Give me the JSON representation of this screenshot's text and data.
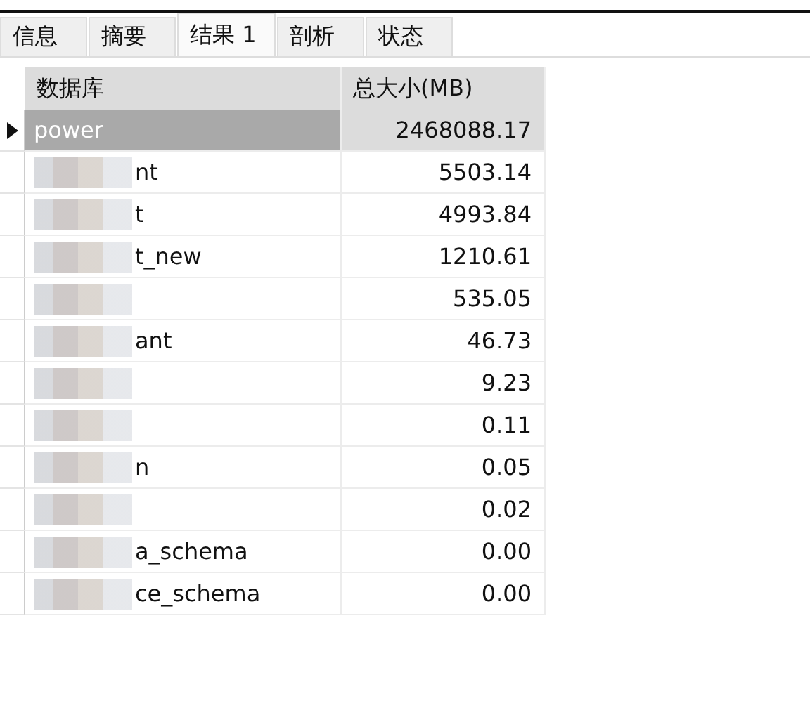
{
  "tabs": [
    {
      "label": "信息",
      "selected": false
    },
    {
      "label": "摘要",
      "selected": false
    },
    {
      "label": "结果 1",
      "selected": true
    },
    {
      "label": "剖析",
      "selected": false
    },
    {
      "label": "状态",
      "selected": false
    }
  ],
  "table": {
    "columns": [
      "数据库",
      "总大小(MB)"
    ],
    "rows": [
      {
        "name": "power",
        "size": "2468088.17",
        "selected": true,
        "redacted": false
      },
      {
        "name": "nt",
        "size": "5503.14",
        "selected": false,
        "redacted": true
      },
      {
        "name": "t",
        "size": "4993.84",
        "selected": false,
        "redacted": true
      },
      {
        "name": "t_new",
        "size": "1210.61",
        "selected": false,
        "redacted": true
      },
      {
        "size": "535.05",
        "selected": false,
        "redacted": true
      },
      {
        "name": "ant",
        "size": "46.73",
        "selected": false,
        "redacted": true
      },
      {
        "size": "9.23",
        "selected": false,
        "redacted": true
      },
      {
        "size": "0.11",
        "selected": false,
        "redacted": true
      },
      {
        "name": "n",
        "size": "0.05",
        "selected": false,
        "redacted": true
      },
      {
        "size": "0.02",
        "selected": false,
        "redacted": true
      },
      {
        "name": "a_schema",
        "size": "0.00",
        "selected": false,
        "redacted": true
      },
      {
        "name": "ce_schema",
        "size": "0.00",
        "selected": false,
        "redacted": true
      }
    ]
  }
}
